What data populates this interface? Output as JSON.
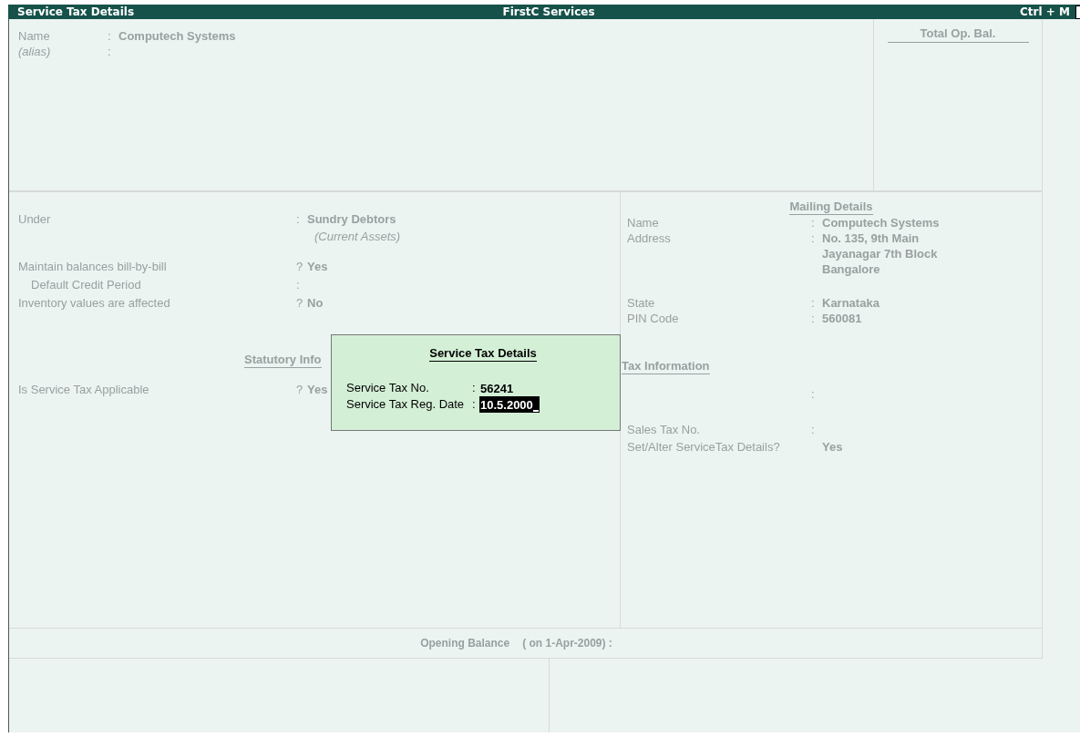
{
  "title_bar": {
    "title": "Service Tax Details",
    "company": "FirstC Services",
    "shortcut": "Ctrl + M"
  },
  "ledger": {
    "fields": [
      {
        "label": "Name",
        "sep": ":",
        "value": "Computech Systems",
        "kind": "plain"
      },
      {
        "label": "(alias)",
        "sep": ":",
        "kind": "alias"
      }
    ],
    "total_heading": "Total Op. Bal."
  },
  "left_groups": [
    [
      {
        "label": "Under",
        "sep": ":",
        "value": "Sundry Debtors",
        "sub": "(Current Assets)"
      }
    ],
    [
      {
        "label": "Maintain balances bill-by-bill",
        "sep": "?",
        "value": "Yes",
        "children": [
          {
            "label": "Default Credit Period",
            "sep": ":"
          }
        ]
      },
      {
        "label": "Inventory values are affected",
        "sep": "?",
        "value": "No"
      }
    ]
  ],
  "statutory": {
    "heading": "Statutory Info",
    "fields": [
      {
        "label": "Is Service Tax Applicable",
        "sep": "?",
        "value": "Yes"
      }
    ]
  },
  "mailing": {
    "heading": "Mailing Details",
    "groups": [
      [
        {
          "label": "Name",
          "sep": ":",
          "lines": [
            "Computech Systems"
          ]
        },
        {
          "label": "Address",
          "sep": ":",
          "lines": [
            "No. 135, 9th Main",
            "Jayanagar 7th Block",
            "Bangalore"
          ]
        }
      ],
      [
        {
          "label": "State",
          "sep": ":",
          "lines": [
            "Karnataka"
          ]
        },
        {
          "label": "PIN Code",
          "sep": ":",
          "lines": [
            "560081"
          ]
        }
      ]
    ]
  },
  "tax_info": {
    "heading": "Tax Information",
    "groups": [
      [
        {
          "sep": ":"
        }
      ],
      [
        {
          "label": "Sales Tax No.",
          "sep": ":"
        },
        {
          "label": "Set/Alter ServiceTax Details?",
          "value": "Yes"
        }
      ]
    ]
  },
  "opening_balance": {
    "label": "Opening Balance",
    "date": "( on 1-Apr-2009) :"
  },
  "dialog": {
    "title": "Service Tax Details",
    "fields": [
      {
        "label": "Service Tax No.",
        "sep": ":",
        "value": "56241",
        "focused": false
      },
      {
        "label": "Service Tax Reg. Date",
        "sep": ":",
        "value": "10.5.2000",
        "focused": true
      }
    ]
  }
}
